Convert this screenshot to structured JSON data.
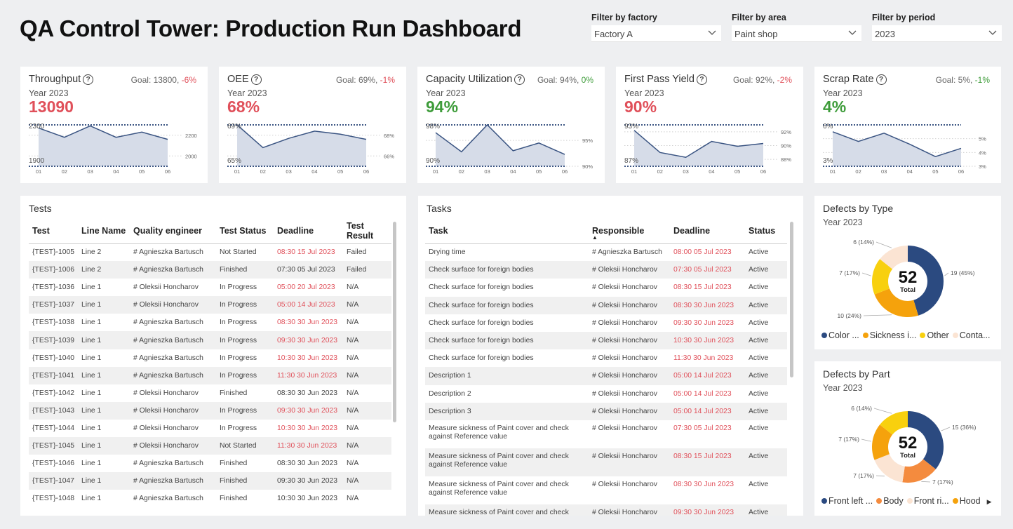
{
  "header": {
    "title": "QA Control Tower: Production Run Dashboard"
  },
  "filters": [
    {
      "label": "Filter by factory",
      "value": "Factory A"
    },
    {
      "label": "Filter by area",
      "value": "Paint shop"
    },
    {
      "label": "Filter by period",
      "value": "2023"
    }
  ],
  "kpis": [
    {
      "title": "Throughput",
      "goal_prefix": "Goal: 13800, ",
      "delta": "-6%",
      "year": "Year 2023",
      "value": "13090",
      "status_color": "#e0505a",
      "axis_left": [
        "2300",
        "1900"
      ],
      "axis_right": [
        "2200",
        "2000"
      ],
      "x_labels": [
        "01",
        "02",
        "03",
        "04",
        "05",
        "06"
      ],
      "series": [
        2270,
        2180,
        2290,
        2180,
        2230,
        2160
      ],
      "ymin": 1900,
      "ymax": 2300,
      "right_ticks": [
        2200,
        2000
      ]
    },
    {
      "title": "OEE",
      "goal_prefix": "Goal: 69%, ",
      "delta": "-1%",
      "year": "Year 2023",
      "value": "68%",
      "status_color": "#e0505a",
      "axis_left": [
        "69%",
        "65%"
      ],
      "axis_right": [
        "68%",
        "66%"
      ],
      "x_labels": [
        "01",
        "02",
        "03",
        "04",
        "05",
        "06"
      ],
      "series": [
        69,
        66.8,
        67.7,
        68.4,
        68.1,
        67.6
      ],
      "ymin": 65,
      "ymax": 69,
      "right_ticks": [
        68,
        66
      ]
    },
    {
      "title": "Capacity Utilization",
      "goal_prefix": "Goal: 94%, ",
      "delta": "0%",
      "year": "Year 2023",
      "value": "94%",
      "status_color": "#3e9c3a",
      "axis_left": [
        "98%",
        "90%"
      ],
      "axis_right": [
        "95%",
        "90%"
      ],
      "x_labels": [
        "01",
        "02",
        "03",
        "04",
        "05",
        "06"
      ],
      "series": [
        96.5,
        92.8,
        98,
        93,
        94.5,
        92.3
      ],
      "ymin": 90,
      "ymax": 98,
      "right_ticks": [
        95,
        90
      ]
    },
    {
      "title": "First Pass Yield",
      "goal_prefix": "Goal: 92%, ",
      "delta": "-2%",
      "year": "Year 2023",
      "value": "90%",
      "status_color": "#e0505a",
      "axis_left": [
        "93%",
        "87%"
      ],
      "axis_right": [
        "92%",
        "90%",
        "88%"
      ],
      "x_labels": [
        "01",
        "02",
        "03",
        "04",
        "05",
        "06"
      ],
      "series": [
        92.2,
        89,
        88.3,
        90.6,
        89.9,
        90.3
      ],
      "ymin": 87,
      "ymax": 93,
      "right_ticks": [
        92,
        90,
        88
      ]
    },
    {
      "title": "Scrap Rate",
      "goal_prefix": "Goal: 5%, ",
      "delta": "-1%",
      "year": "Year 2023",
      "value": "4%",
      "status_color": "#3e9c3a",
      "axis_left": [
        "6%",
        "3%"
      ],
      "axis_right": [
        "5%",
        "4%",
        "3%"
      ],
      "x_labels": [
        "01",
        "02",
        "03",
        "04",
        "05",
        "06"
      ],
      "series": [
        5.5,
        4.8,
        5.4,
        4.6,
        3.7,
        4.3
      ],
      "ymin": 3,
      "ymax": 6,
      "right_ticks": [
        5,
        4,
        3
      ]
    }
  ],
  "tests": {
    "title": "Tests",
    "columns": [
      "Test",
      "Line Name",
      "Quality engineer",
      "Test Status",
      "Deadline",
      "Test Result"
    ],
    "rows": [
      [
        "{TEST}-1005",
        "Line 2",
        "# Agnieszka Bartusch",
        "Not Started",
        "08:30 15 Jul 2023",
        "Failed",
        "r"
      ],
      [
        "{TEST}-1006",
        "Line 2",
        "# Agnieszka Bartusch",
        "Finished",
        "07:30 05 Jul 2023",
        "Failed",
        ""
      ],
      [
        "{TEST}-1036",
        "Line 1",
        "# Oleksii Honcharov",
        "In Progress",
        "05:00 20 Jul 2023",
        "N/A",
        "r"
      ],
      [
        "{TEST}-1037",
        "Line 1",
        "# Oleksii Honcharov",
        "In Progress",
        "05:00 14 Jul 2023",
        "N/A",
        "r"
      ],
      [
        "{TEST}-1038",
        "Line 1",
        "# Agnieszka Bartusch",
        "In Progress",
        "08:30 30 Jun 2023",
        "N/A",
        "r"
      ],
      [
        "{TEST}-1039",
        "Line 1",
        "# Agnieszka Bartusch",
        "In Progress",
        "09:30 30 Jun 2023",
        "N/A",
        "r"
      ],
      [
        "{TEST}-1040",
        "Line 1",
        "# Agnieszka Bartusch",
        "In Progress",
        "10:30 30 Jun 2023",
        "N/A",
        "r"
      ],
      [
        "{TEST}-1041",
        "Line 1",
        "# Agnieszka Bartusch",
        "In Progress",
        "11:30 30 Jun 2023",
        "N/A",
        "r"
      ],
      [
        "{TEST}-1042",
        "Line 1",
        "# Oleksii Honcharov",
        "Finished",
        "08:30 30 Jun 2023",
        "N/A",
        ""
      ],
      [
        "{TEST}-1043",
        "Line 1",
        "# Oleksii Honcharov",
        "In Progress",
        "09:30 30 Jun 2023",
        "N/A",
        "r"
      ],
      [
        "{TEST}-1044",
        "Line 1",
        "# Oleksii Honcharov",
        "In Progress",
        "10:30 30 Jun 2023",
        "N/A",
        "r"
      ],
      [
        "{TEST}-1045",
        "Line 1",
        "# Oleksii Honcharov",
        "Not Started",
        "11:30 30 Jun 2023",
        "N/A",
        "r"
      ],
      [
        "{TEST}-1046",
        "Line 1",
        "# Agnieszka Bartusch",
        "Finished",
        "08:30 30 Jun 2023",
        "N/A",
        ""
      ],
      [
        "{TEST}-1047",
        "Line 1",
        "# Agnieszka Bartusch",
        "Finished",
        "09:30 30 Jun 2023",
        "N/A",
        ""
      ],
      [
        "{TEST}-1048",
        "Line 1",
        "# Agnieszka Bartusch",
        "Finished",
        "10:30 30 Jun 2023",
        "N/A",
        ""
      ]
    ]
  },
  "tasks": {
    "title": "Tasks",
    "columns": [
      "Task",
      "Responsible",
      "Deadline",
      "Status"
    ],
    "rows": [
      [
        "Drying time",
        "# Agnieszka Bartusch",
        "08:00 05 Jul 2023",
        "Active"
      ],
      [
        "Check surface for foreign bodies",
        "# Oleksii Honcharov",
        "07:30 05 Jul 2023",
        "Active"
      ],
      [
        "Check surface for foreign bodies",
        "# Oleksii Honcharov",
        "08:30 15 Jul 2023",
        "Active"
      ],
      [
        "Check surface for foreign bodies",
        "# Oleksii Honcharov",
        "08:30 30 Jun 2023",
        "Active"
      ],
      [
        "Check surface for foreign bodies",
        "# Oleksii Honcharov",
        "09:30 30 Jun 2023",
        "Active"
      ],
      [
        "Check surface for foreign bodies",
        "# Oleksii Honcharov",
        "10:30 30 Jun 2023",
        "Active"
      ],
      [
        "Check surface for foreign bodies",
        "# Oleksii Honcharov",
        "11:30 30 Jun 2023",
        "Active"
      ],
      [
        "Description 1",
        "# Oleksii Honcharov",
        "05:00 14 Jul 2023",
        "Active"
      ],
      [
        "Description 2",
        "# Oleksii Honcharov",
        "05:00 14 Jul 2023",
        "Active"
      ],
      [
        "Description 3",
        "# Oleksii Honcharov",
        "05:00 14 Jul 2023",
        "Active"
      ],
      [
        "Measure sickness of Paint cover and check against Reference value",
        "# Oleksii Honcharov",
        "07:30 05 Jul 2023",
        "Active"
      ],
      [
        "Measure sickness of Paint cover and check against Reference value",
        "# Oleksii Honcharov",
        "08:30 15 Jul 2023",
        "Active"
      ],
      [
        "Measure sickness of Paint cover and check against Reference value",
        "# Oleksii Honcharov",
        "08:30 30 Jun 2023",
        "Active"
      ],
      [
        "Measure sickness of Paint cover and check",
        "# Oleksii Honcharov",
        "09:30 30 Jun 2023",
        "Active"
      ]
    ]
  },
  "defects_type": {
    "title": "Defects by Type",
    "year": "Year 2023",
    "total": "52",
    "total_label": "Total",
    "slices": [
      {
        "label": "19 (45%)",
        "value": 19,
        "color": "#2b4a80"
      },
      {
        "label": "10 (24%)",
        "value": 10,
        "color": "#f5a20c"
      },
      {
        "label": "7 (17%)",
        "value": 7,
        "color": "#f8d00e"
      },
      {
        "label": "6 (14%)",
        "value": 6,
        "color": "#fbe4d3"
      }
    ],
    "legend": [
      {
        "text": "Color ...",
        "color": "#2b4a80"
      },
      {
        "text": "Sickness i...",
        "color": "#f5a20c"
      },
      {
        "text": "Other",
        "color": "#f8d00e"
      },
      {
        "text": "Conta...",
        "color": "#fbe4d3"
      }
    ]
  },
  "defects_part": {
    "title": "Defects by Part",
    "year": "Year 2023",
    "total": "52",
    "total_label": "Total",
    "slices": [
      {
        "label": "15 (36%)",
        "value": 15,
        "color": "#2b4a80"
      },
      {
        "label": "7 (17%)",
        "value": 7,
        "color": "#f48b3e"
      },
      {
        "label": "7 (17%)",
        "value": 7,
        "color": "#fbe4d3"
      },
      {
        "label": "7 (17%)",
        "value": 7,
        "color": "#f5a20c"
      },
      {
        "label": "6 (14%)",
        "value": 6,
        "color": "#f8d00e"
      }
    ],
    "legend": [
      {
        "text": "Front left ...",
        "color": "#2b4a80"
      },
      {
        "text": "Body",
        "color": "#f48b3e"
      },
      {
        "text": "Front ri...",
        "color": "#fbe4d3"
      },
      {
        "text": "Hood",
        "color": "#f5a20c"
      }
    ],
    "more_glyph": "▶"
  }
}
